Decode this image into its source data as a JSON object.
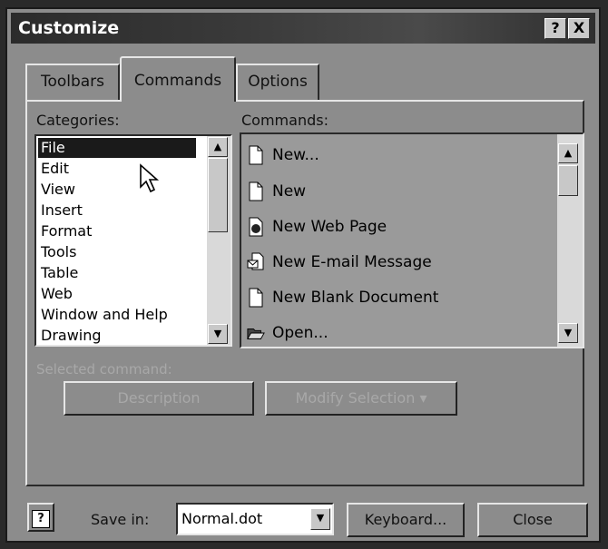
{
  "window": {
    "title": "Customize"
  },
  "title_buttons": {
    "help": "?",
    "close": "X"
  },
  "tabs": [
    {
      "label": "Toolbars"
    },
    {
      "label": "Commands"
    },
    {
      "label": "Options"
    }
  ],
  "categories": {
    "label": "Categories:",
    "items": [
      "File",
      "Edit",
      "View",
      "Insert",
      "Format",
      "Tools",
      "Table",
      "Web",
      "Window and Help",
      "Drawing"
    ],
    "selected": "File"
  },
  "commands": {
    "label": "Commands:",
    "items": [
      {
        "label": "New...",
        "icon": "blank-doc-icon"
      },
      {
        "label": "New",
        "icon": "blank-doc-icon"
      },
      {
        "label": "New Web Page",
        "icon": "web-page-icon"
      },
      {
        "label": "New E-mail Message",
        "icon": "email-doc-icon"
      },
      {
        "label": "New Blank Document",
        "icon": "blank-doc-icon"
      },
      {
        "label": "Open...",
        "icon": "open-folder-icon"
      }
    ]
  },
  "selected_command": {
    "label": "Selected command:",
    "description_button": "Description",
    "modify_button": "Modify Selection ▾"
  },
  "footer": {
    "help_icon": "?",
    "save_in_label": "Save in:",
    "save_in_value": "Normal.dot",
    "keyboard_button": "Keyboard...",
    "close_button": "Close"
  }
}
